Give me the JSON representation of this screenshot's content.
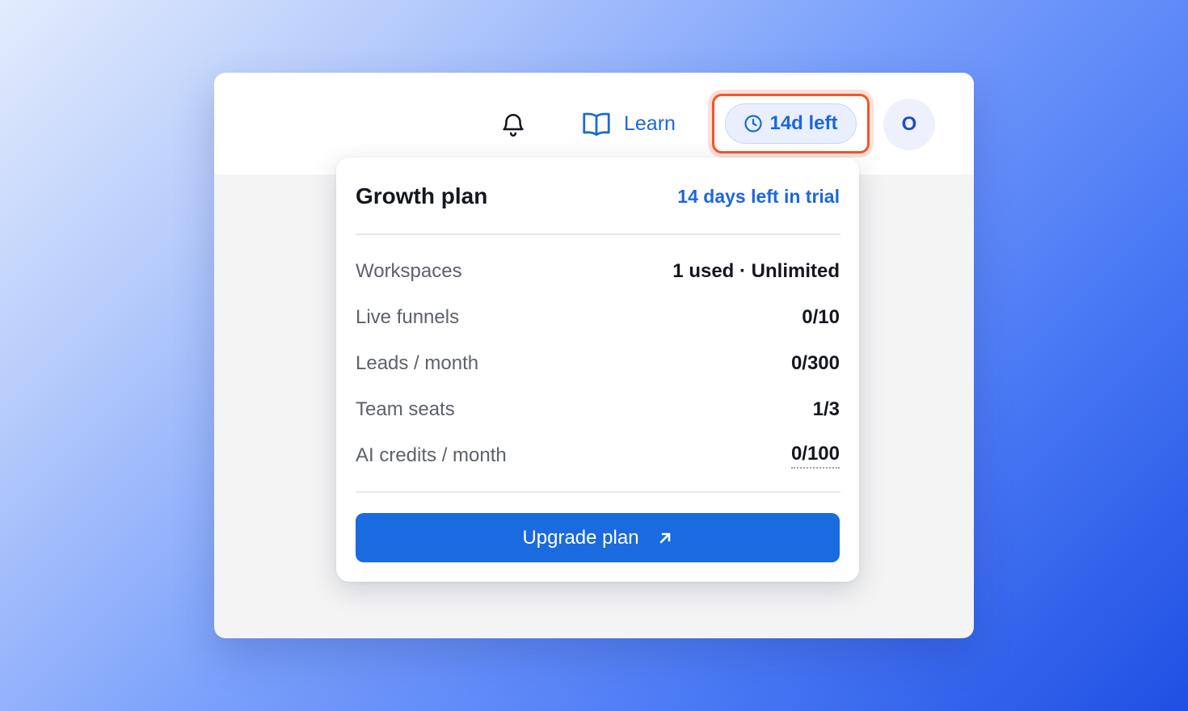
{
  "header": {
    "learn_label": "Learn",
    "trial_badge": "14d left",
    "avatar_initial": "O"
  },
  "plan_popover": {
    "plan_name": "Growth plan",
    "trial_status": "14 days left in trial",
    "rows": [
      {
        "label": "Workspaces",
        "value": "1 used · Unlimited"
      },
      {
        "label": "Live funnels",
        "value": "0/10"
      },
      {
        "label": "Leads / month",
        "value": "0/300"
      },
      {
        "label": "Team seats",
        "value": "1/3"
      },
      {
        "label": "AI credits / month",
        "value": "0/100"
      }
    ],
    "upgrade_label": "Upgrade plan"
  },
  "icons": [
    "bell-icon",
    "book-icon",
    "clock-icon",
    "arrow-up-right-icon"
  ],
  "colors": {
    "accent": "#1d67da",
    "button": "#1a6ae0",
    "highlight": "#f2552b"
  }
}
